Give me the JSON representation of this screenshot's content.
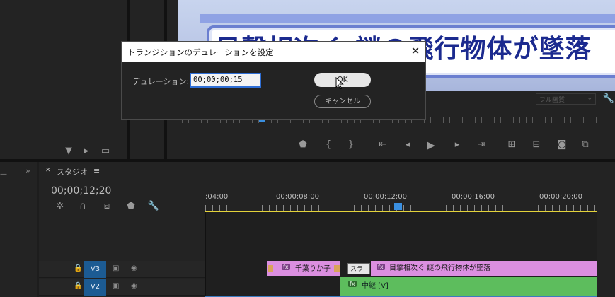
{
  "dialog": {
    "title": "トランジションのデュレーションを設定",
    "duration_label": "デュレーション:",
    "duration_value": "00;00;00;15",
    "ok_label": "OK",
    "cancel_label": "キャンセル",
    "close_glyph": "✕"
  },
  "program_monitor": {
    "banner_text": "目撃相次ぐ 謎の飛行物体が墜落",
    "quality": "フル画質",
    "playback_buttons": [
      "marker-icon",
      "mark-in-icon",
      "mark-out-icon",
      "go-to-in-icon",
      "step-back-icon",
      "play-icon",
      "step-forward-icon",
      "go-to-out-icon",
      "lift-icon",
      "extract-icon",
      "camera-icon",
      "compare-icon"
    ]
  },
  "timeline": {
    "tab_label": "スタジオ",
    "tab_close": "✕",
    "tab_menu": "≡",
    "current_timecode": "00;00;12;20",
    "ruler_labels": [
      ";04;00",
      "00;00;08;00",
      "00;00;12;00",
      "00;00;16;00",
      "00;00;20;00"
    ],
    "tracks": [
      {
        "id": "V3",
        "clips": [
          {
            "label": "千葉りか子",
            "fx": "fx"
          },
          {
            "label": "スラ",
            "type": "transition"
          },
          {
            "label": "目撃相次ぐ 謎の飛行物体が墜落",
            "fx": "fx"
          }
        ]
      },
      {
        "id": "V2",
        "clips": [
          {
            "label": "中継 [V]",
            "fx": "fx"
          }
        ]
      }
    ]
  },
  "colors": {
    "accent_blue": "#2f6fd6",
    "clip_pink": "#db8fe0",
    "clip_green": "#5dbd5d",
    "work_area": "#e3d23a"
  }
}
